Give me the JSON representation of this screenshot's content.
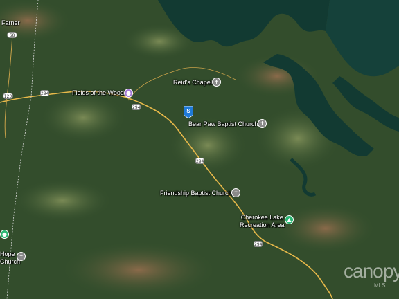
{
  "map": {
    "type": "satellite",
    "colors": {
      "forest": "#2f4a2a",
      "water": "#123a32",
      "road": "#e8b94a",
      "church_poi": "#8a8a8a",
      "attraction_poi": "#a57bd6",
      "park_poi": "#2bb673",
      "listing_pin": "#1f7ad8"
    }
  },
  "places": [
    {
      "id": "farner",
      "label": "Farner",
      "icon": null
    },
    {
      "id": "fields-of-the-wood",
      "label": "Fields of the Wood",
      "icon": "attraction-icon"
    },
    {
      "id": "reids-chapel",
      "label": "Reid's Chapel",
      "icon": "church-icon"
    },
    {
      "id": "bear-paw-baptist-church",
      "label": "Bear Paw Baptist Church",
      "icon": "church-icon"
    },
    {
      "id": "friendship-baptist-church",
      "label": "Friendship Baptist Church",
      "icon": "church-icon"
    },
    {
      "id": "cherokee-lake-recreation-area",
      "label": "Cherokee Lake\nRecreation Area",
      "icon": "park-icon"
    },
    {
      "id": "hope-church",
      "label": "Hope\nChurch",
      "icon": "church-icon"
    }
  ],
  "route_shields": [
    {
      "id": "shield-68",
      "number": "68"
    },
    {
      "id": "shield-123",
      "number": "123"
    },
    {
      "id": "shield-294-a",
      "number": "294"
    },
    {
      "id": "shield-294-b",
      "number": "294"
    },
    {
      "id": "shield-294-c",
      "number": "294"
    },
    {
      "id": "shield-294-d",
      "number": "294"
    }
  ],
  "listing_pin": {
    "label": "S"
  },
  "watermark": {
    "brand": "canopy",
    "sub": "MLS"
  }
}
